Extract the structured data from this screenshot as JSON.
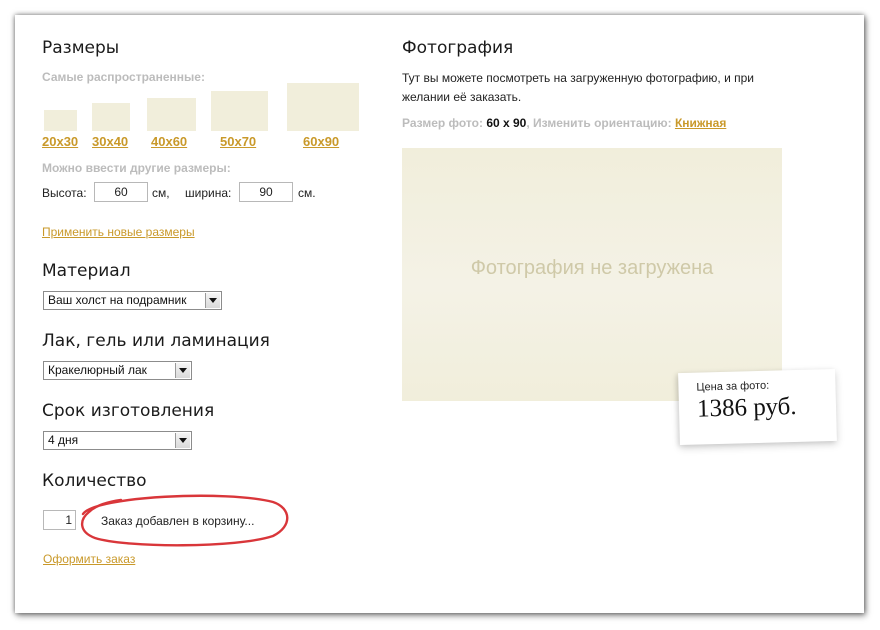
{
  "sizes": {
    "title": "Размеры",
    "common_label": "Самые распространенные:",
    "presets": [
      "20x30",
      "30x40",
      "40x60",
      "50x70",
      "60x90"
    ],
    "other_label": "Можно ввести другие размеры:",
    "height_label": "Высота:",
    "height_value": "60",
    "height_unit": "см,",
    "width_label": "ширина:",
    "width_value": "90",
    "width_unit": "см.",
    "apply_link": "Применить новые размеры"
  },
  "material": {
    "title": "Материал",
    "selected": "Ваш холст на подрамник"
  },
  "varnish": {
    "title": "Лак, гель или ламинация",
    "selected": "Кракелюрный лак"
  },
  "term": {
    "title": "Срок изготовления",
    "selected": "4 дня"
  },
  "quantity": {
    "title": "Количество",
    "value": "1",
    "status": "Заказ добавлен в корзину...",
    "checkout_link": "Оформить заказ"
  },
  "photo": {
    "title": "Фотография",
    "description": "Тут вы можете посмотреть на загруженную фотографию, и при желании её заказать.",
    "size_label": "Размер фото:",
    "size_value": "60 x 90",
    "orientation_label": ", Изменить ориентацию:",
    "orientation_value": "Книжная",
    "placeholder": "Фотография не загружена"
  },
  "price": {
    "label": "Цена за фото:",
    "value": "1386 руб."
  },
  "colors": {
    "accent": "#c9992a",
    "swatch": "#f1eedb",
    "highlight_circle": "#d9363a"
  }
}
